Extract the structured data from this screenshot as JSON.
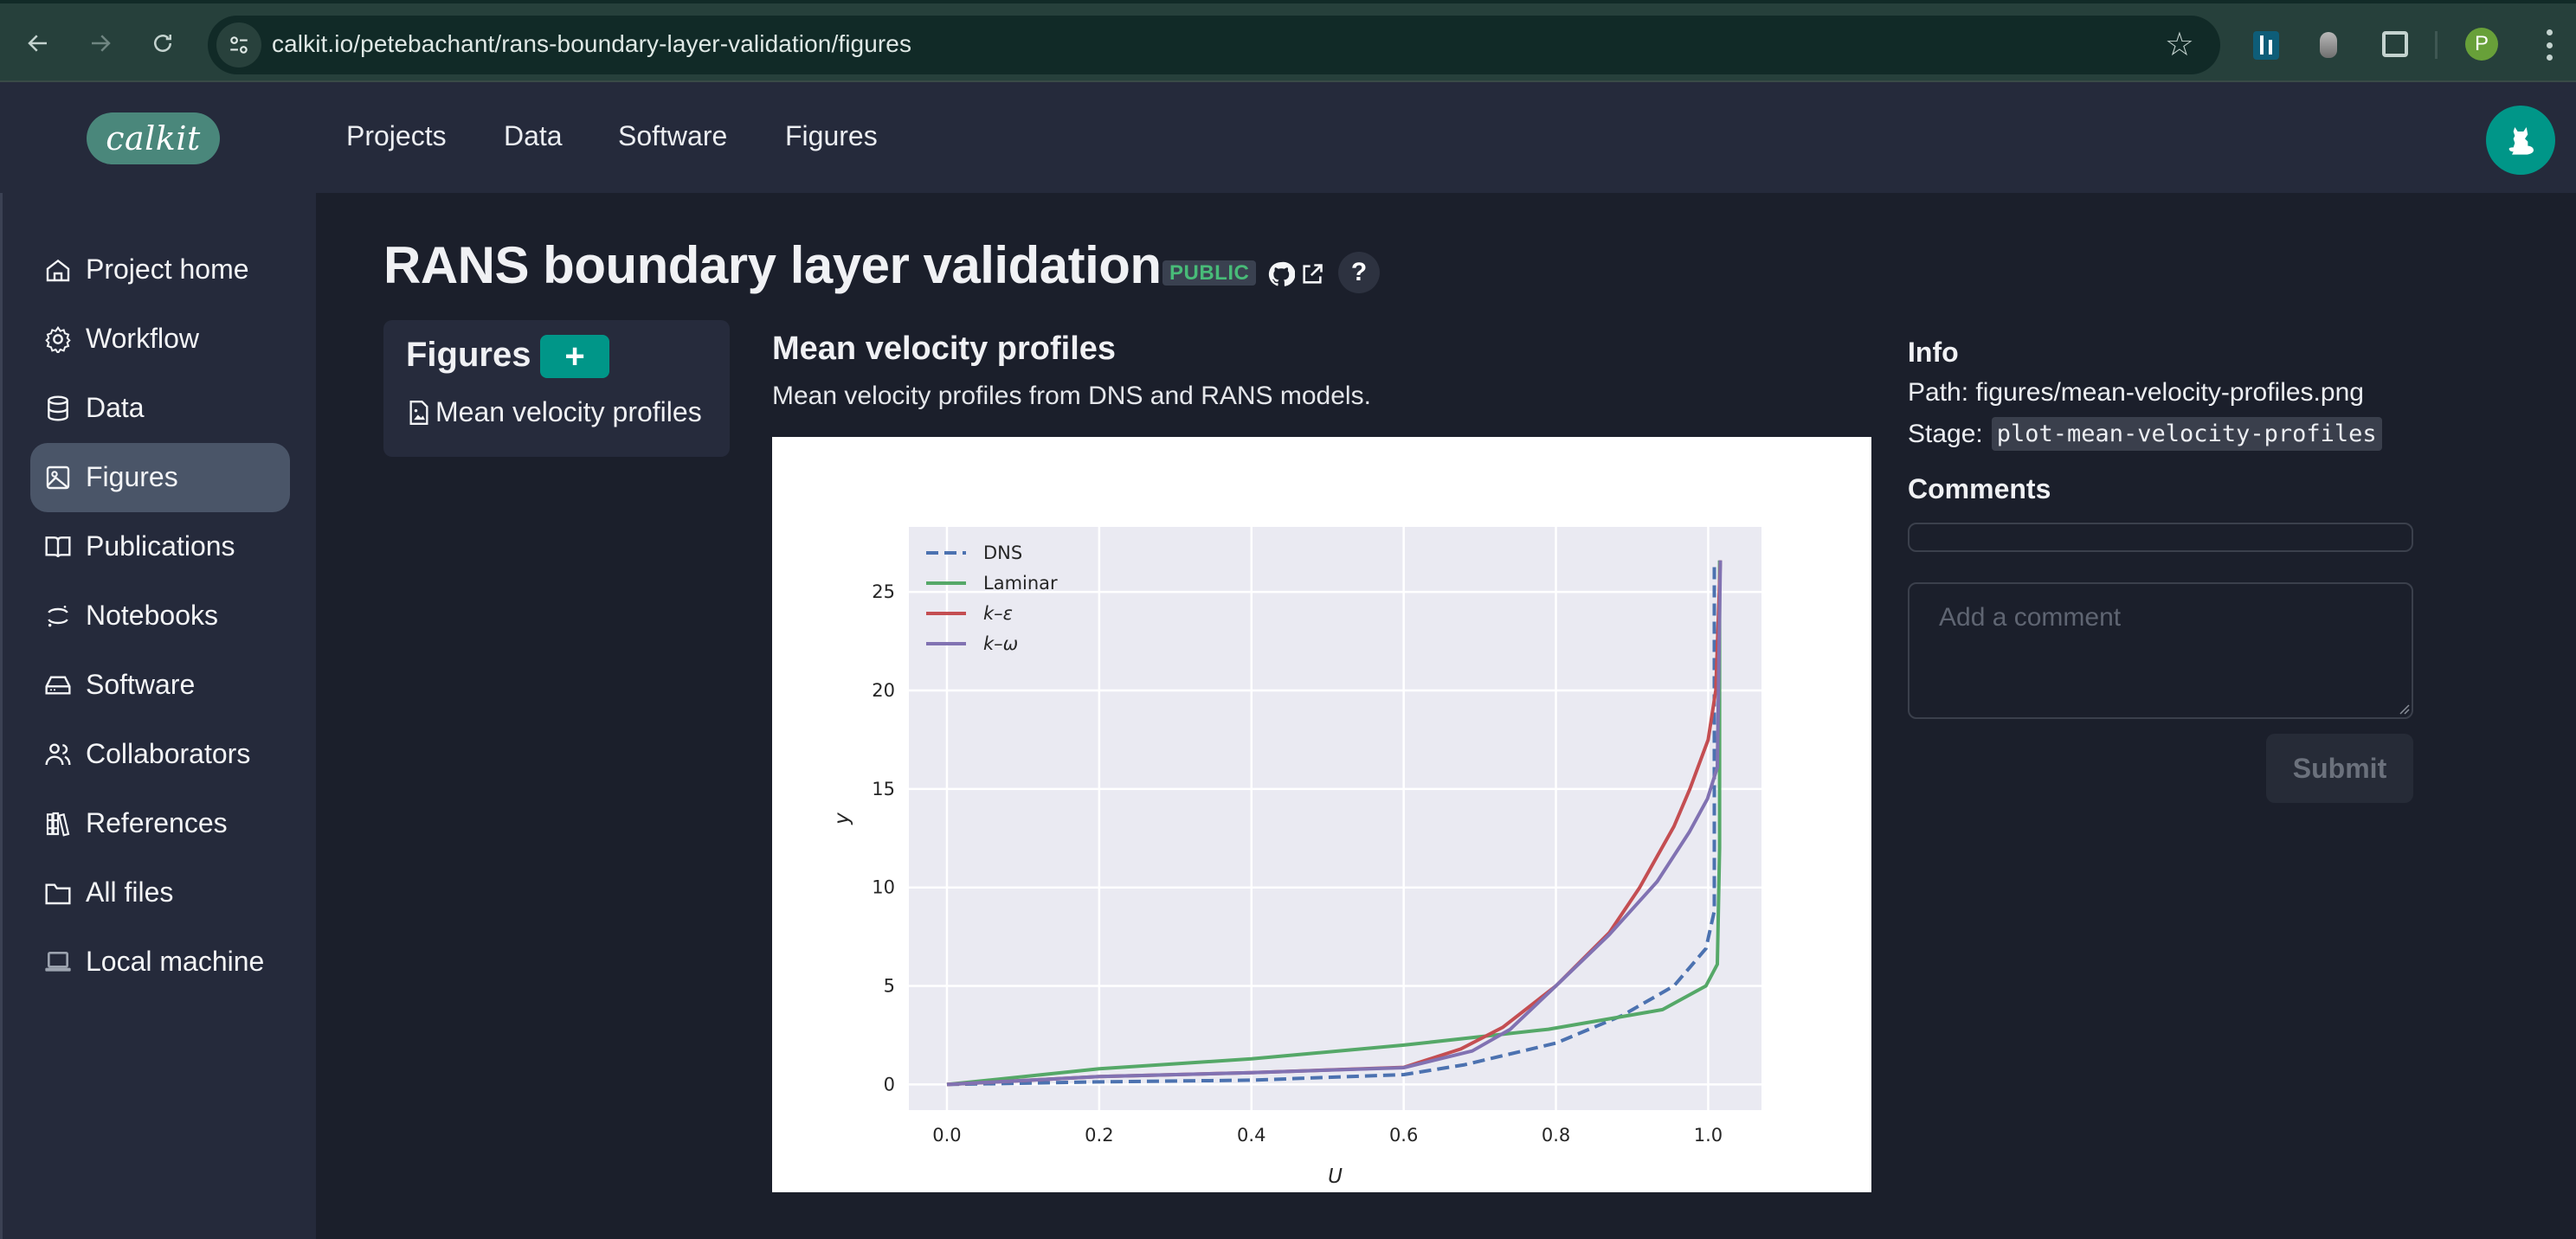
{
  "browser": {
    "url": "calkit.io/petebachant/rans-boundary-layer-validation/figures",
    "profile_initial": "P",
    "icons": [
      "back-arrow-icon",
      "forward-arrow-icon",
      "reload-icon",
      "site-info-icon",
      "bookmark-star-icon",
      "extension-icon",
      "extension-bug-icon",
      "extensions-puzzle-icon",
      "kebab-menu-icon"
    ]
  },
  "app": {
    "logo": "calkit",
    "nav": [
      {
        "label": "Projects"
      },
      {
        "label": "Data"
      },
      {
        "label": "Software"
      },
      {
        "label": "Figures"
      }
    ],
    "accent_color": "#009688"
  },
  "sidebar": {
    "active": "Figures",
    "items": [
      {
        "label": "Project home",
        "icon": "home-icon"
      },
      {
        "label": "Workflow",
        "icon": "gear-icon"
      },
      {
        "label": "Data",
        "icon": "database-icon"
      },
      {
        "label": "Figures",
        "icon": "image-icon"
      },
      {
        "label": "Publications",
        "icon": "book-icon"
      },
      {
        "label": "Notebooks",
        "icon": "jupyter-icon"
      },
      {
        "label": "Software",
        "icon": "hard-drive-icon"
      },
      {
        "label": "Collaborators",
        "icon": "users-icon"
      },
      {
        "label": "References",
        "icon": "library-icon"
      },
      {
        "label": "All files",
        "icon": "folder-icon"
      },
      {
        "label": "Local machine",
        "icon": "laptop-icon"
      }
    ]
  },
  "project": {
    "title": "RANS boundary layer validation",
    "visibility": "PUBLIC",
    "help": "?"
  },
  "figures_panel": {
    "title": "Figures",
    "add_label": "+",
    "items": [
      {
        "label": "Mean velocity profiles"
      }
    ]
  },
  "figure": {
    "title": "Mean velocity profiles",
    "description": "Mean velocity profiles from DNS and RANS models."
  },
  "info": {
    "title": "Info",
    "path_label": "Path:",
    "path": "figures/mean-velocity-profiles.png",
    "stage_label": "Stage:",
    "stage": "plot-mean-velocity-profiles",
    "comments_title": "Comments",
    "comment_placeholder": "Add a comment",
    "submit_label": "Submit"
  },
  "chart_data": {
    "type": "line",
    "title": "",
    "xlabel": "U",
    "ylabel": "y",
    "xlim": [
      -0.05,
      1.07
    ],
    "ylim": [
      -1.3,
      28.3
    ],
    "xticks": [
      "0.0",
      "0.2",
      "0.4",
      "0.6",
      "0.8",
      "1.0"
    ],
    "yticks": [
      "0",
      "5",
      "10",
      "15",
      "20",
      "25"
    ],
    "grid": true,
    "legend_position": "top-left",
    "series": [
      {
        "name": "DNS",
        "style": "dashed",
        "color": "#4c72b0",
        "x": [
          0.0,
          0.2,
          0.4,
          0.6,
          0.68,
          0.8,
          0.887,
          0.955,
          0.997,
          1.008,
          1.008,
          1.008
        ],
        "y": [
          0.0,
          0.13,
          0.22,
          0.5,
          1.0,
          2.1,
          3.5,
          5.0,
          6.9,
          8.8,
          15.0,
          26.5
        ]
      },
      {
        "name": "Laminar",
        "style": "solid",
        "color": "#55a868",
        "x": [
          0.0,
          0.2,
          0.4,
          0.6,
          0.79,
          0.94,
          0.997,
          1.012,
          1.015,
          1.015
        ],
        "y": [
          0.0,
          0.8,
          1.3,
          2.0,
          2.8,
          3.8,
          5.0,
          6.1,
          12.0,
          26.6
        ]
      },
      {
        "name": "k–ε",
        "style": "solid",
        "color": "#c44e52",
        "x": [
          0.0,
          0.2,
          0.4,
          0.6,
          0.675,
          0.73,
          0.8,
          0.87,
          0.91,
          0.955,
          0.976,
          1.0,
          1.01,
          1.016
        ],
        "y": [
          0.0,
          0.4,
          0.6,
          0.87,
          1.8,
          2.9,
          5.0,
          7.7,
          10.0,
          13.1,
          15.0,
          17.5,
          20.0,
          26.6
        ]
      },
      {
        "name": "k–ω",
        "style": "solid",
        "color": "#8172b2",
        "x": [
          0.0,
          0.2,
          0.4,
          0.6,
          0.69,
          0.74,
          0.8,
          0.87,
          0.933,
          0.975,
          0.999,
          1.012,
          1.016
        ],
        "y": [
          0.0,
          0.4,
          0.6,
          0.85,
          1.7,
          2.8,
          5.0,
          7.6,
          10.3,
          12.8,
          14.5,
          16.1,
          26.6
        ]
      }
    ]
  }
}
